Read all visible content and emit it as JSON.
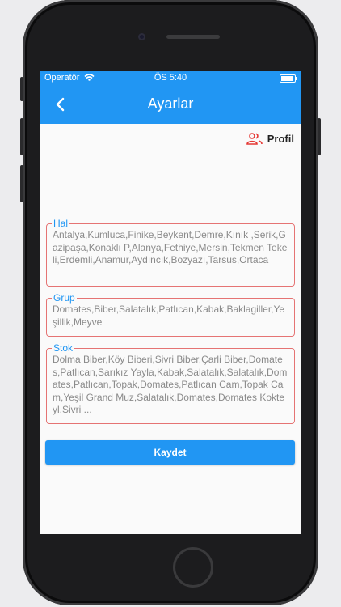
{
  "status_bar": {
    "carrier": "Operatör",
    "time": "ÖS 5:40"
  },
  "header": {
    "title": "Ayarlar"
  },
  "profile": {
    "label": "Profil"
  },
  "fields": {
    "hal": {
      "label": "Hal",
      "value": "Antalya,Kumluca,Finike,Beykent,Demre,Kınık ,Serik,Gazipaşa,Konaklı P,Alanya,Fethiye,Mersin,Tekmen Tekeli,Erdemli,Anamur,Aydıncık,Bozyazı,Tarsus,Ortaca"
    },
    "grup": {
      "label": "Grup",
      "value": "Domates,Biber,Salatalık,Patlıcan,Kabak,Baklagiller,Yeşillik,Meyve"
    },
    "stok": {
      "label": "Stok",
      "value": "Dolma Biber,Köy Biberi,Sivri Biber,Çarli Biber,Domates,Patlıcan,Sarıkız Yayla,Kabak,Salatalık,Salatalık,Domates,Patlıcan,Topak,Domates,Patlıcan Cam,Topak Cam,Yeşil Grand Muz,Salatalık,Domates,Domates Kokteyl,Sivri ..."
    }
  },
  "save_button": {
    "label": "Kaydet"
  },
  "colors": {
    "primary": "#2196f3",
    "error_border": "#e57373",
    "profile_icon": "#e53935"
  }
}
